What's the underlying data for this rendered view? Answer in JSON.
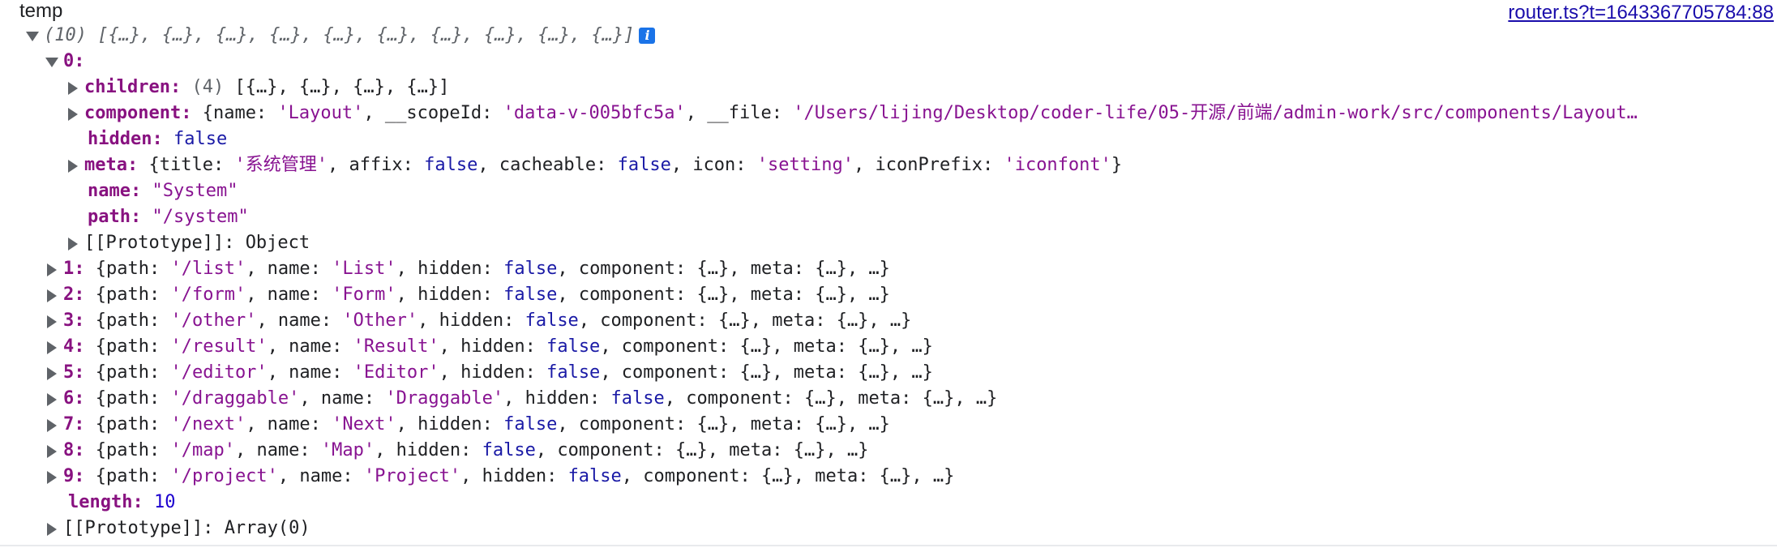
{
  "header": {
    "var_name": "temp",
    "source_link": "router.ts?t=1643367705784:88"
  },
  "root": {
    "summary": "(10) [{…}, {…}, {…}, {…}, {…}, {…}, {…}, {…}, {…}, {…}]"
  },
  "item0": {
    "index": "0:",
    "children_key": "children:",
    "children_count": "(4)",
    "children_preview": "[{…}, {…}, {…}, {…}]",
    "component_key": "component:",
    "component_preview": [
      {
        "t": "txt",
        "v": "{"
      },
      {
        "t": "txt",
        "v": "name: "
      },
      {
        "t": "strp",
        "v": "'Layout'"
      },
      {
        "t": "txt",
        "v": ", __scopeId: "
      },
      {
        "t": "strp",
        "v": "'data-v-005bfc5a'"
      },
      {
        "t": "txt",
        "v": ", __file: "
      },
      {
        "t": "strp",
        "v": "'/Users/lijing/Desktop/coder-life/05-开源/前端/admin-work/src/components/Layout…"
      }
    ],
    "hidden_key": "hidden:",
    "hidden_val": "false",
    "meta_key": "meta:",
    "meta_preview": [
      {
        "t": "txt",
        "v": "{title: "
      },
      {
        "t": "strp",
        "v": "'系统管理'"
      },
      {
        "t": "txt",
        "v": ", affix: "
      },
      {
        "t": "kw",
        "v": "false"
      },
      {
        "t": "txt",
        "v": ", cacheable: "
      },
      {
        "t": "kw",
        "v": "false"
      },
      {
        "t": "txt",
        "v": ", icon: "
      },
      {
        "t": "strp",
        "v": "'setting'"
      },
      {
        "t": "txt",
        "v": ", iconPrefix: "
      },
      {
        "t": "strp",
        "v": "'iconfont'"
      },
      {
        "t": "txt",
        "v": "}"
      }
    ],
    "name_key": "name:",
    "name_val": "\"System\"",
    "path_key": "path:",
    "path_val": "\"/system\"",
    "proto_key": "[[Prototype]]:",
    "proto_val": "Object"
  },
  "items": [
    {
      "index": "1:",
      "path": "'/list'",
      "name": "'List'"
    },
    {
      "index": "2:",
      "path": "'/form'",
      "name": "'Form'"
    },
    {
      "index": "3:",
      "path": "'/other'",
      "name": "'Other'"
    },
    {
      "index": "4:",
      "path": "'/result'",
      "name": "'Result'"
    },
    {
      "index": "5:",
      "path": "'/editor'",
      "name": "'Editor'"
    },
    {
      "index": "6:",
      "path": "'/draggable'",
      "name": "'Draggable'"
    },
    {
      "index": "7:",
      "path": "'/next'",
      "name": "'Next'"
    },
    {
      "index": "8:",
      "path": "'/map'",
      "name": "'Map'"
    },
    {
      "index": "9:",
      "path": "'/project'",
      "name": "'Project'"
    }
  ],
  "row_text": {
    "open": "{path: ",
    "name_label": ", name: ",
    "hidden_label": ", hidden: ",
    "hidden_val": "false",
    "tail": ", component: {…}, meta: {…}, …}"
  },
  "length": {
    "key": "length:",
    "val": "10"
  },
  "array_proto": {
    "key": "[[Prototype]]:",
    "val": "Array(0)"
  }
}
